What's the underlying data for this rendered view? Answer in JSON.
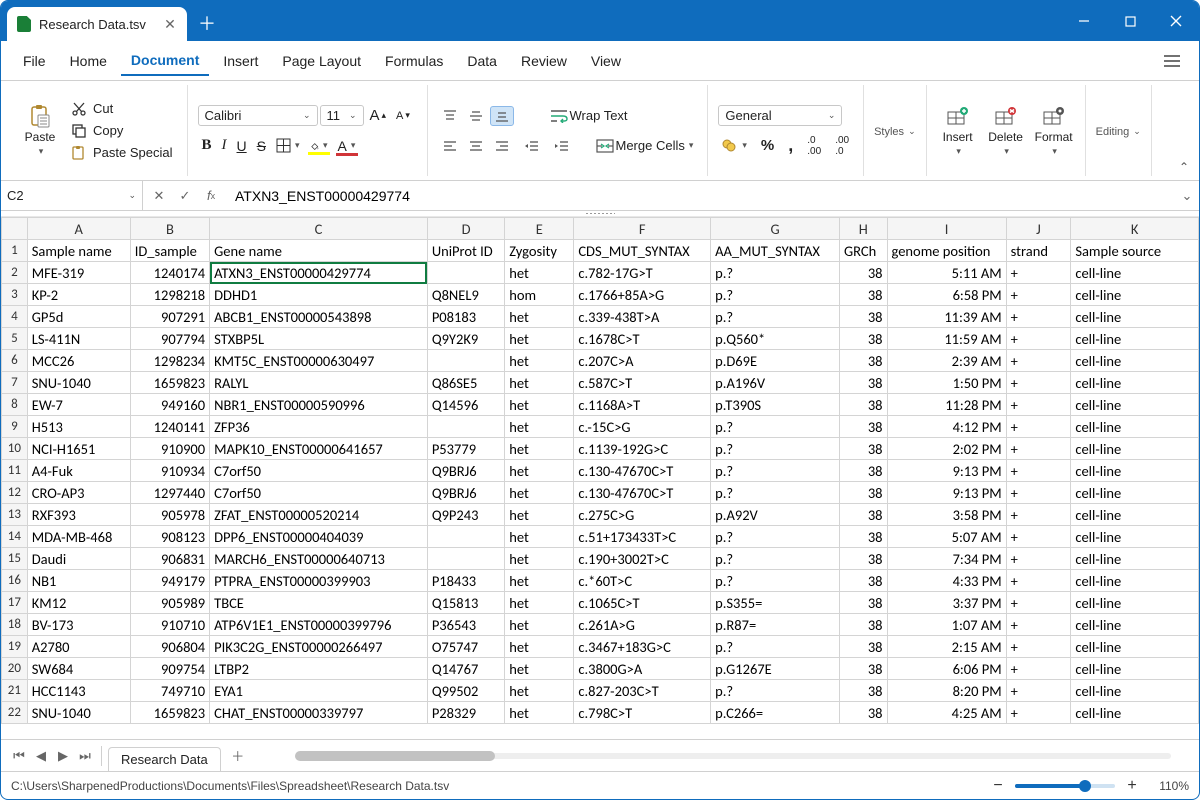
{
  "window": {
    "tab_title": "Research Data.tsv"
  },
  "menu": {
    "items": [
      "File",
      "Home",
      "Document",
      "Insert",
      "Page Layout",
      "Formulas",
      "Data",
      "Review",
      "View"
    ],
    "active_index": 2
  },
  "ribbon": {
    "paste": "Paste",
    "cut": "Cut",
    "copy": "Copy",
    "paste_special": "Paste Special",
    "font_name": "Calibri",
    "font_size": "11",
    "wrap_text": "Wrap Text",
    "merge_cells": "Merge Cells",
    "number_format": "General",
    "styles": "Styles",
    "insert": "Insert",
    "delete": "Delete",
    "format": "Format",
    "editing": "Editing"
  },
  "fbar": {
    "cell_ref": "C2",
    "formula": "ATXN3_ENST00000429774"
  },
  "columns": [
    "A",
    "B",
    "C",
    "D",
    "E",
    "F",
    "G",
    "H",
    "I",
    "J",
    "K"
  ],
  "headers": [
    "Sample name",
    "ID_sample",
    "Gene name",
    "UniProt ID",
    "Zygosity",
    "CDS_MUT_SYNTAX",
    "AA_MUT_SYNTAX",
    "GRCh",
    "genome position",
    "strand",
    "Sample source"
  ],
  "rows": [
    [
      "MFE-319",
      "1240174",
      "ATXN3_ENST00000429774",
      "",
      "het",
      "c.782-17G>T",
      "p.?",
      "38",
      "5:11 AM",
      "+",
      "cell-line"
    ],
    [
      "KP-2",
      "1298218",
      "DDHD1",
      "Q8NEL9",
      "hom",
      "c.1766+85A>G",
      "p.?",
      "38",
      "6:58 PM",
      "+",
      "cell-line"
    ],
    [
      "GP5d",
      "907291",
      "ABCB1_ENST00000543898",
      "P08183",
      "het",
      "c.339-438T>A",
      "p.?",
      "38",
      "11:39 AM",
      "+",
      "cell-line"
    ],
    [
      "LS-411N",
      "907794",
      "STXBP5L",
      "Q9Y2K9",
      "het",
      "c.1678C>T",
      "p.Q560*",
      "38",
      "11:59 AM",
      "+",
      "cell-line"
    ],
    [
      "MCC26",
      "1298234",
      "KMT5C_ENST00000630497",
      "",
      "het",
      "c.207C>A",
      "p.D69E",
      "38",
      "2:39 AM",
      "+",
      "cell-line"
    ],
    [
      "SNU-1040",
      "1659823",
      "RALYL",
      "Q86SE5",
      "het",
      "c.587C>T",
      "p.A196V",
      "38",
      "1:50 PM",
      "+",
      "cell-line"
    ],
    [
      "EW-7",
      "949160",
      "NBR1_ENST00000590996",
      "Q14596",
      "het",
      "c.1168A>T",
      "p.T390S",
      "38",
      "11:28 PM",
      "+",
      "cell-line"
    ],
    [
      "H513",
      "1240141",
      "ZFP36",
      "",
      "het",
      "c.-15C>G",
      "p.?",
      "38",
      "4:12 PM",
      "+",
      "cell-line"
    ],
    [
      "NCI-H1651",
      "910900",
      "MAPK10_ENST00000641657",
      "P53779",
      "het",
      "c.1139-192G>C",
      "p.?",
      "38",
      "2:02 PM",
      "+",
      "cell-line"
    ],
    [
      "A4-Fuk",
      "910934",
      "C7orf50",
      "Q9BRJ6",
      "het",
      "c.130-47670C>T",
      "p.?",
      "38",
      "9:13 PM",
      "+",
      "cell-line"
    ],
    [
      "CRO-AP3",
      "1297440",
      "C7orf50",
      "Q9BRJ6",
      "het",
      "c.130-47670C>T",
      "p.?",
      "38",
      "9:13 PM",
      "+",
      "cell-line"
    ],
    [
      "RXF393",
      "905978",
      "ZFAT_ENST00000520214",
      "Q9P243",
      "het",
      "c.275C>G",
      "p.A92V",
      "38",
      "3:58 PM",
      "+",
      "cell-line"
    ],
    [
      "MDA-MB-468",
      "908123",
      "DPP6_ENST00000404039",
      "",
      "het",
      "c.51+173433T>C",
      "p.?",
      "38",
      "5:07 AM",
      "+",
      "cell-line"
    ],
    [
      "Daudi",
      "906831",
      "MARCH6_ENST00000640713",
      "",
      "het",
      "c.190+3002T>C",
      "p.?",
      "38",
      "7:34 PM",
      "+",
      "cell-line"
    ],
    [
      "NB1",
      "949179",
      "PTPRA_ENST00000399903",
      "P18433",
      "het",
      "c.*60T>C",
      "p.?",
      "38",
      "4:33 PM",
      "+",
      "cell-line"
    ],
    [
      "KM12",
      "905989",
      "TBCE",
      "Q15813",
      "het",
      "c.1065C>T",
      "p.S355=",
      "38",
      "3:37 PM",
      "+",
      "cell-line"
    ],
    [
      "BV-173",
      "910710",
      "ATP6V1E1_ENST00000399796",
      "P36543",
      "het",
      "c.261A>G",
      "p.R87=",
      "38",
      "1:07 AM",
      "+",
      "cell-line"
    ],
    [
      "A2780",
      "906804",
      "PIK3C2G_ENST00000266497",
      "O75747",
      "het",
      "c.3467+183G>C",
      "p.?",
      "38",
      "2:15 AM",
      "+",
      "cell-line"
    ],
    [
      "SW684",
      "909754",
      "LTBP2",
      "Q14767",
      "het",
      "c.3800G>A",
      "p.G1267E",
      "38",
      "6:06 PM",
      "+",
      "cell-line"
    ],
    [
      "HCC1143",
      "749710",
      "EYA1",
      "Q99502",
      "het",
      "c.827-203C>T",
      "p.?",
      "38",
      "8:20 PM",
      "+",
      "cell-line"
    ],
    [
      "SNU-1040",
      "1659823",
      "CHAT_ENST00000339797",
      "P28329",
      "het",
      "c.798C>T",
      "p.C266=",
      "38",
      "4:25 AM",
      "+",
      "cell-line"
    ]
  ],
  "selected": {
    "row": 2,
    "col": 2,
    "col_letter": "C"
  },
  "sheet_tabs": [
    "Research Data"
  ],
  "status": {
    "path": "C:\\Users\\SharpenedProductions\\Documents\\Files\\Spreadsheet\\Research Data.tsv",
    "zoom": "110%"
  }
}
